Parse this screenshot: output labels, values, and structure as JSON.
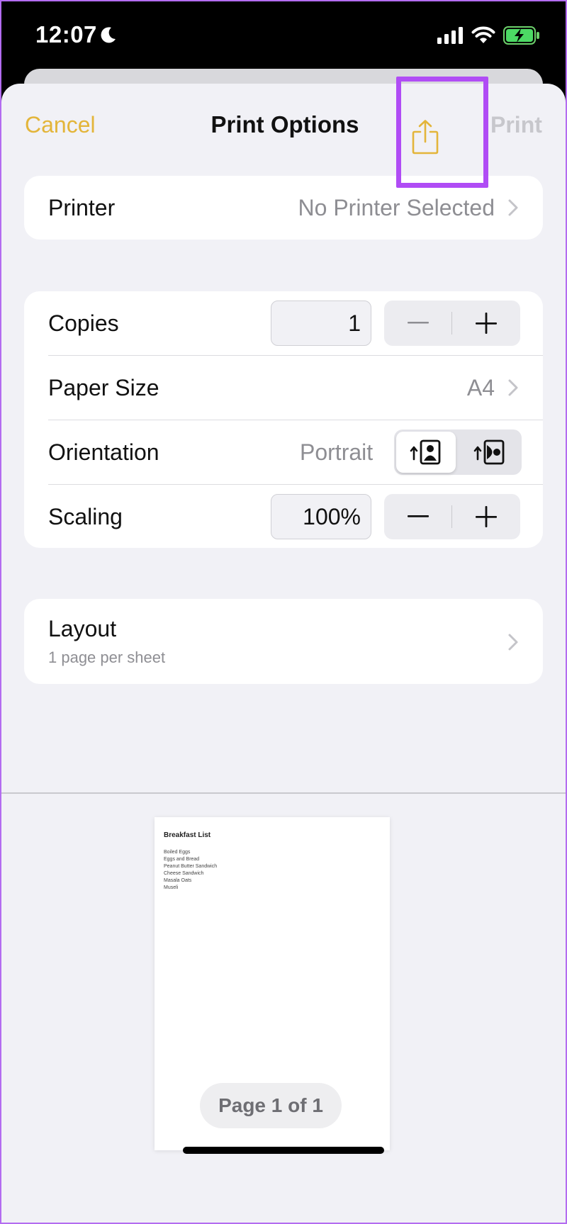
{
  "status_bar": {
    "time": "12:07"
  },
  "nav": {
    "cancel_label": "Cancel",
    "title": "Print Options",
    "print_label": "Print"
  },
  "printer": {
    "label": "Printer",
    "value": "No Printer Selected"
  },
  "copies": {
    "label": "Copies",
    "value": "1"
  },
  "paper_size": {
    "label": "Paper Size",
    "value": "A4"
  },
  "orientation": {
    "label": "Orientation",
    "value": "Portrait"
  },
  "scaling": {
    "label": "Scaling",
    "value": "100%"
  },
  "layout": {
    "label": "Layout",
    "subtitle": "1 page per sheet"
  },
  "preview": {
    "doc_title": "Breakfast List",
    "items": [
      "Boiled Eggs",
      "Eggs and Bread",
      "Peanut Butter Sandwich",
      "Cheese Sandwich",
      "Masala Oats",
      "Museli"
    ],
    "page_indicator": "Page 1 of 1"
  },
  "colors": {
    "accent": "#e3b53a",
    "highlight": "#b04cf5",
    "disabled": "#c7c7cc"
  },
  "icons": [
    "moon-icon",
    "signal-icon",
    "wifi-icon",
    "battery-charging-icon",
    "share-icon",
    "chevron-right-icon",
    "minus-icon",
    "plus-icon",
    "portrait-orientation-icon",
    "landscape-orientation-icon"
  ]
}
